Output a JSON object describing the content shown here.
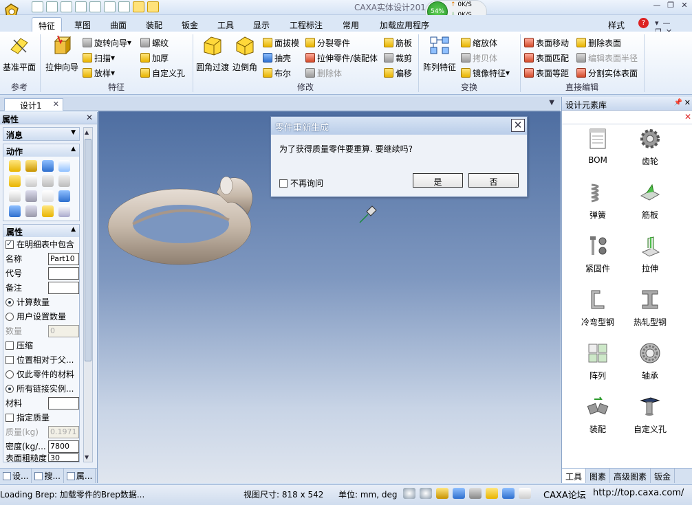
{
  "app": {
    "title": "CAXA实体设计201",
    "perf_percent": "54%",
    "upload_rate": "0K/S",
    "download_rate": "0K/S"
  },
  "ribbon_tabs": [
    "特征",
    "草图",
    "曲面",
    "装配",
    "钣金",
    "工具",
    "显示",
    "工程标注",
    "常用",
    "加载应用程序"
  ],
  "ribbon_right": {
    "style_label": "样式"
  },
  "ribbon": {
    "reference": {
      "label": "参考",
      "datum_plane": "基准平面"
    },
    "feature": {
      "label": "特征",
      "extrude_wizard": "拉伸向导",
      "revolve_wizard": "旋转向导",
      "sweep": "扫描",
      "loft": "放样",
      "thread": "螺纹",
      "thicken": "加厚",
      "custom_hole": "自定义孔"
    },
    "modify": {
      "label": "修改",
      "fillet": "圆角过渡",
      "chamfer": "边倒角",
      "draft": "面拔模",
      "shell": "抽壳",
      "boolean": "布尔",
      "split_part": "分裂零件",
      "extrude_part": "拉伸零件/装配体",
      "delete_body": "删除体",
      "rib": "筋板",
      "trim": "裁剪",
      "offset": "偏移"
    },
    "transform": {
      "label": "变换",
      "pattern_feature": "阵列特征",
      "scale_body": "缩放体",
      "copy_body": "拷贝体",
      "mirror_feature": "镜像特征"
    },
    "direct_edit": {
      "label": "直接编辑",
      "face_move": "表面移动",
      "face_match": "表面匹配",
      "face_equidistant": "表面等距",
      "delete_face": "删除表面",
      "edit_face_radius": "编辑表面半径",
      "split_solid_face": "分割实体表面"
    }
  },
  "document_tab": "设计1",
  "left_panel": {
    "title": "属性",
    "sections": {
      "message": "消息",
      "action": "动作",
      "properties": "属性"
    },
    "include_in_bom": "在明细表中包含",
    "name_label": "名称",
    "name_value": "Part10",
    "code_label": "代号",
    "code_value": "",
    "remark_label": "备注",
    "remark_value": "",
    "calc_qty": "计算数量",
    "user_qty": "用户设置数量",
    "qty_label": "数量",
    "qty_value": "0",
    "compress": "压缩",
    "position_relative": "位置相对于父...",
    "only_this_material": "仅此零件的材料",
    "all_linked_instances": "所有链接实例...",
    "material_label": "材料",
    "material_value": "",
    "specify_mass": "指定质量",
    "mass_label": "质量(kg)",
    "mass_value": "0.1971",
    "density_label": "密度(kg/...",
    "density_value": "7800",
    "roughness_label": "表面粗糙度",
    "roughness_value": "30",
    "bottom_tabs": [
      "设...",
      "搜...",
      "属..."
    ]
  },
  "dialog": {
    "title": "零件重新生成",
    "message": "为了获得质量零件要重算. 要继续吗?",
    "dont_ask": "不再询问",
    "yes": "是",
    "no": "否"
  },
  "right_panel": {
    "title": "设计元素库",
    "items": [
      "BOM",
      "齿轮",
      "弹簧",
      "筋板",
      "紧固件",
      "拉伸",
      "冷弯型钢",
      "热轧型钢",
      "阵列",
      "轴承",
      "装配",
      "自定义孔"
    ],
    "tabs": [
      "工具",
      "图素",
      "高级图素",
      "钣金"
    ]
  },
  "status": {
    "message": "Loading Brep: 加载零件的Brep数据...",
    "view_size": "视图尺寸: 818 x 542",
    "units": "单位: mm, deg",
    "forum": "CAXA论坛",
    "url": "http://top.caxa.com/"
  }
}
